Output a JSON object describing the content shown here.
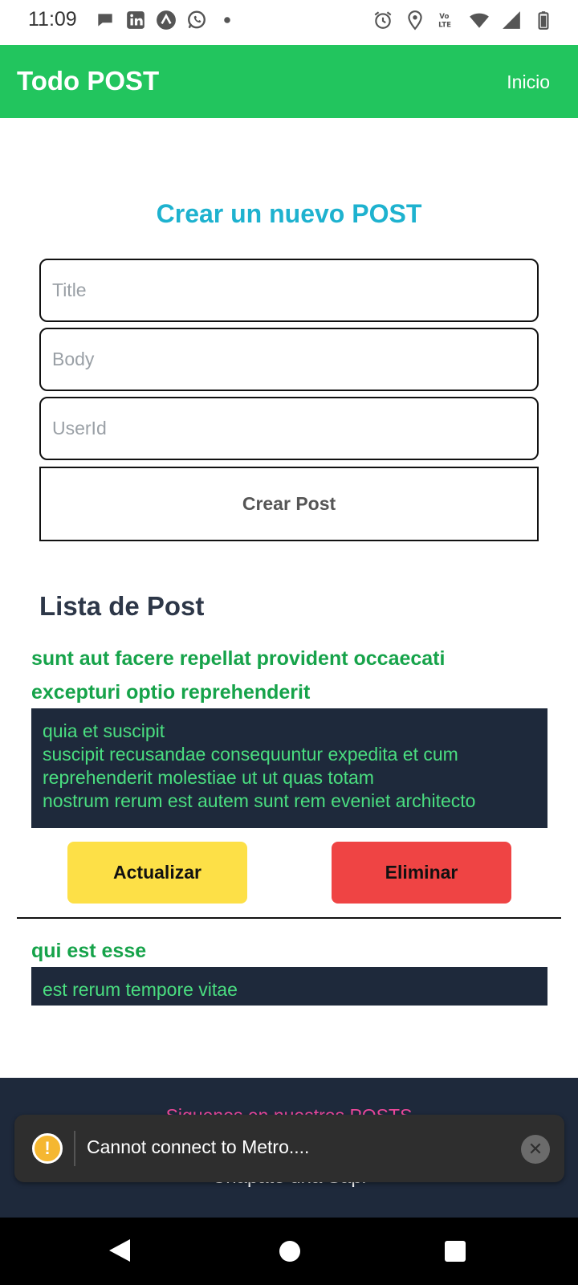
{
  "status_bar": {
    "time": "11:09",
    "left_icons": [
      "chat-bubble-icon",
      "linkedin-icon",
      "expo-icon",
      "whatsapp-icon",
      "dot-icon"
    ],
    "right_icons": [
      "alarm-icon",
      "location-icon",
      "volte-icon",
      "wifi-icon",
      "signal-icon",
      "battery-icon"
    ]
  },
  "app_bar": {
    "title": "Todo POST",
    "nav_link": "Inicio",
    "color": "#22c55e"
  },
  "form": {
    "heading": "Crear un nuevo POST",
    "title_placeholder": "Title",
    "body_placeholder": "Body",
    "userid_placeholder": "UserId",
    "submit_label": "Crear Post"
  },
  "list": {
    "heading": "Lista de Post",
    "posts": [
      {
        "title": "sunt aut facere repellat provident occaecati excepturi optio reprehenderit",
        "body": "quia et suscipit\nsuscipit recusandae consequuntur expedita et cum\nreprehenderit molestiae ut ut quas totam\nnostrum rerum est autem sunt rem eveniet architecto",
        "update_label": "Actualizar",
        "delete_label": "Eliminar"
      },
      {
        "title": "qui est esse",
        "body": "est rerum tempore vitae"
      }
    ]
  },
  "footer": {
    "line1": "Siguenos en nuestros POSTS",
    "line2": "Chapate una Sapi"
  },
  "toast": {
    "message": "Cannot connect to Metro....",
    "icon": "warning-icon"
  },
  "colors": {
    "accent": "#22c55e",
    "heading": "#1eb2cf",
    "post_title": "#16a34a",
    "post_body_bg": "#1e293b",
    "post_body_text": "#4ade80",
    "update": "#fde047",
    "delete": "#ef4444",
    "footer_bg": "#1e293b",
    "footer_link": "#ec4899"
  }
}
